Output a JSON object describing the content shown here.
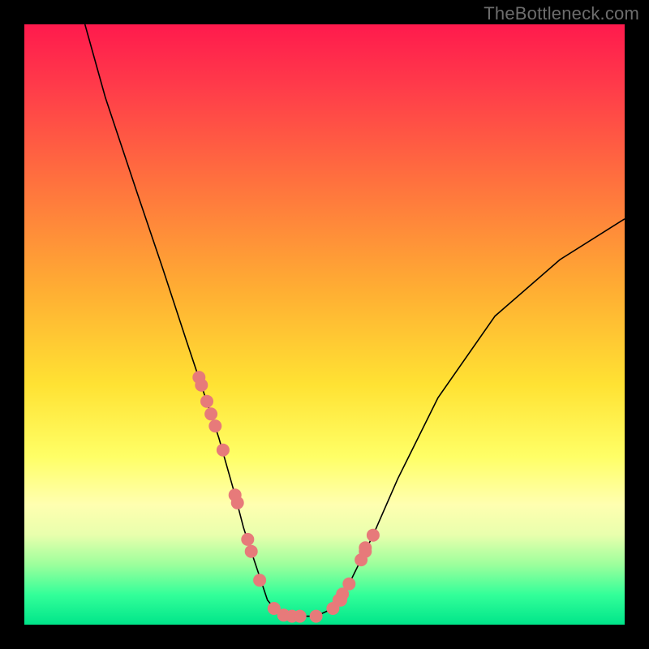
{
  "watermark": "TheBottleneck.com",
  "chart_data": {
    "type": "line",
    "title": "",
    "xlabel": "",
    "ylabel": "",
    "xlim": [
      0,
      100
    ],
    "ylim": [
      0,
      100
    ],
    "note": "Axes are unlabeled; values are approximate percentages of the plot area read from pixel positions (0 = left/bottom, 100 = right/top).",
    "series": [
      {
        "name": "curve",
        "x": [
          10.1,
          13.5,
          18.9,
          23.0,
          27.0,
          29.7,
          32.4,
          35.1,
          36.5,
          37.8,
          40.5,
          41.9,
          43.2,
          45.9,
          48.6,
          51.4,
          54.1,
          58.1,
          62.2,
          68.9,
          78.4,
          89.2,
          100.0
        ],
        "y": [
          100.0,
          87.8,
          71.6,
          59.5,
          47.3,
          39.2,
          31.1,
          21.6,
          16.2,
          12.2,
          4.1,
          2.4,
          1.6,
          1.4,
          1.4,
          2.7,
          6.8,
          14.9,
          24.3,
          37.8,
          51.4,
          60.8,
          67.6
        ]
      }
    ],
    "scatter": {
      "name": "markers",
      "x": [
        29.1,
        29.5,
        30.4,
        31.1,
        31.8,
        33.1,
        35.1,
        35.5,
        37.2,
        37.8,
        39.2,
        41.6,
        43.2,
        44.6,
        45.9,
        48.6,
        51.4,
        52.4,
        52.7,
        53.0,
        54.1,
        56.1,
        56.8,
        56.8,
        58.1
      ],
      "y": [
        41.2,
        39.9,
        37.2,
        35.1,
        33.1,
        29.1,
        21.6,
        20.3,
        14.2,
        12.2,
        7.4,
        2.7,
        1.6,
        1.4,
        1.4,
        1.4,
        2.7,
        4.1,
        4.1,
        5.1,
        6.8,
        10.8,
        12.2,
        12.8,
        14.9
      ]
    },
    "background_gradient": {
      "orientation": "vertical",
      "stops": [
        {
          "pos": 0.0,
          "color": "#ff1a4d"
        },
        {
          "pos": 0.1,
          "color": "#ff3a4a"
        },
        {
          "pos": 0.25,
          "color": "#ff6d3f"
        },
        {
          "pos": 0.44,
          "color": "#ffad33"
        },
        {
          "pos": 0.6,
          "color": "#ffe233"
        },
        {
          "pos": 0.72,
          "color": "#ffff66"
        },
        {
          "pos": 0.8,
          "color": "#ffffb0"
        },
        {
          "pos": 0.85,
          "color": "#e9ffad"
        },
        {
          "pos": 0.9,
          "color": "#9cff9c"
        },
        {
          "pos": 0.95,
          "color": "#33ff99"
        },
        {
          "pos": 1.0,
          "color": "#00e58a"
        }
      ]
    }
  }
}
